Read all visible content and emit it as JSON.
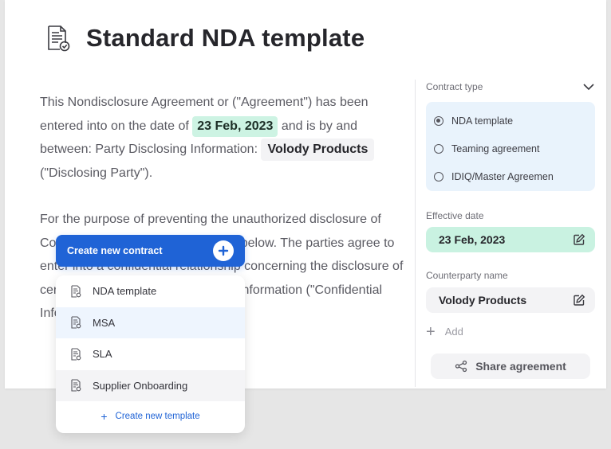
{
  "document": {
    "title": "Standard NDA template",
    "paragraph1": {
      "part1": "This Nondisclosure Agreement or (\"Agreement\") has been entered into on the date of ",
      "date": "23 Feb, 2023",
      "part2": " and is by and between: Party Disclosing Information: ",
      "party": "Volody Products",
      "part3": " (\"Disclosing Party\")."
    },
    "paragraph2": "For the purpose of preventing the unauthorized disclosure of Confidential Information as defined below. The parties agree to enter into a confidential relationship concerning the disclosure of certain proprietary and confidential information (\"Confidential Information\")."
  },
  "sidebar": {
    "contract_type_label": "Contract type",
    "contract_types": [
      {
        "label": "NDA template",
        "selected": true
      },
      {
        "label": "Teaming agreement",
        "selected": false
      },
      {
        "label": "IDIQ/Master Agreemen",
        "selected": false
      }
    ],
    "effective_date_label": "Effective date",
    "effective_date_value": "23 Feb, 2023",
    "counterparty_label": "Counterparty name",
    "counterparty_value": "Volody Products",
    "add_label": "Add",
    "share_label": "Share agreement"
  },
  "create_menu": {
    "button_label": "Create new contract",
    "items": [
      {
        "label": "NDA template",
        "icon": "document-icon"
      },
      {
        "label": "MSA",
        "icon": "document-icon"
      },
      {
        "label": "SLA",
        "icon": "document-icon"
      },
      {
        "label": "Supplier Onboarding",
        "icon": "document-icon"
      }
    ],
    "footer_label": "Create new template"
  },
  "colors": {
    "accent_blue": "#1f63d6",
    "date_highlight": "#cdf3e3",
    "radio_panel": "#e9f3fc"
  }
}
